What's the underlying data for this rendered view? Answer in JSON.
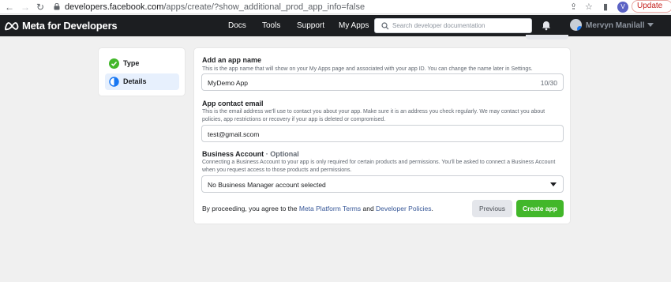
{
  "browser": {
    "url_host": "developers.facebook.com",
    "url_path": "/apps/create/?show_additional_prod_app_info=false",
    "profile_initial": "V",
    "update_label": "Update"
  },
  "topbar": {
    "logo_text": "Meta for Developers",
    "nav": [
      "Docs",
      "Tools",
      "Support",
      "My Apps"
    ],
    "search_placeholder": "Search developer documentation",
    "user_name": "Mervyn Manilall"
  },
  "steps": [
    {
      "label": "Type",
      "state": "complete"
    },
    {
      "label": "Details",
      "state": "active"
    }
  ],
  "form": {
    "app_name": {
      "label": "Add an app name",
      "help": "This is the app name that will show on your My Apps page and associated with your app ID. You can change the name later in Settings.",
      "value": "MyDemo App",
      "counter": "10/30"
    },
    "contact_email": {
      "label": "App contact email",
      "help": "This is the email address we'll use to contact you about your app. Make sure it is an address you check regularly. We may contact you about policies, app restrictions or recovery if your app is deleted or compromised.",
      "value": "test@gmail.scom"
    },
    "business_account": {
      "label": "Business Account",
      "optional": "· Optional",
      "help": "Connecting a Business Account to your app is only required for certain products and permissions. You'll be asked to connect a Business Account when you request access to those products and permissions.",
      "selected": "No Business Manager account selected"
    },
    "terms": {
      "prefix": "By proceeding, you agree to the ",
      "link1": "Meta Platform Terms",
      "middle": " and ",
      "link2": "Developer Policies",
      "suffix": "."
    },
    "previous_label": "Previous",
    "create_label": "Create app"
  },
  "colors": {
    "topbar": "#1c1e21",
    "create_button": "#42b72a",
    "link": "#385898",
    "active_step": "#e7f0fd"
  }
}
